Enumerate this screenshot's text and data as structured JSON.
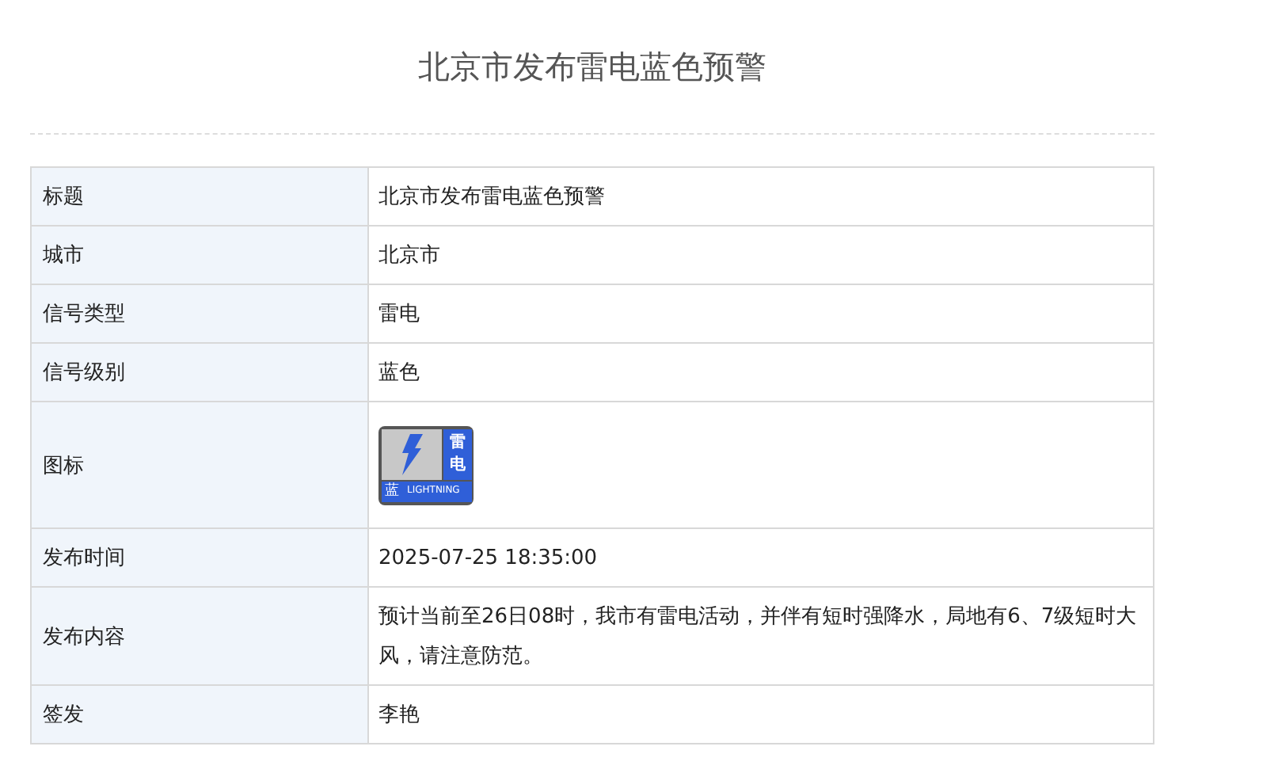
{
  "title": "北京市发布雷电蓝色预警",
  "rows": [
    {
      "kind": "text",
      "label": "标题",
      "value": "北京市发布雷电蓝色预警"
    },
    {
      "kind": "text",
      "label": "城市",
      "value": "北京市"
    },
    {
      "kind": "text",
      "label": "信号类型",
      "value": "雷电"
    },
    {
      "kind": "text",
      "label": "信号级别",
      "value": "蓝色"
    },
    {
      "kind": "sign",
      "label": "图标",
      "sign": {
        "name": "雷电",
        "level": "蓝",
        "english": "LIGHTNING",
        "color": "#2f5fd8"
      }
    },
    {
      "kind": "text",
      "label": "发布时间",
      "value": "2025-07-25 18:35:00"
    },
    {
      "kind": "text",
      "label": "发布内容",
      "value": "预计当前至26日08时，我市有雷电活动，并伴有短时强降水，局地有6、7级短时大风，请注意防范。"
    },
    {
      "kind": "text",
      "label": "签发",
      "value": "李艳"
    }
  ]
}
